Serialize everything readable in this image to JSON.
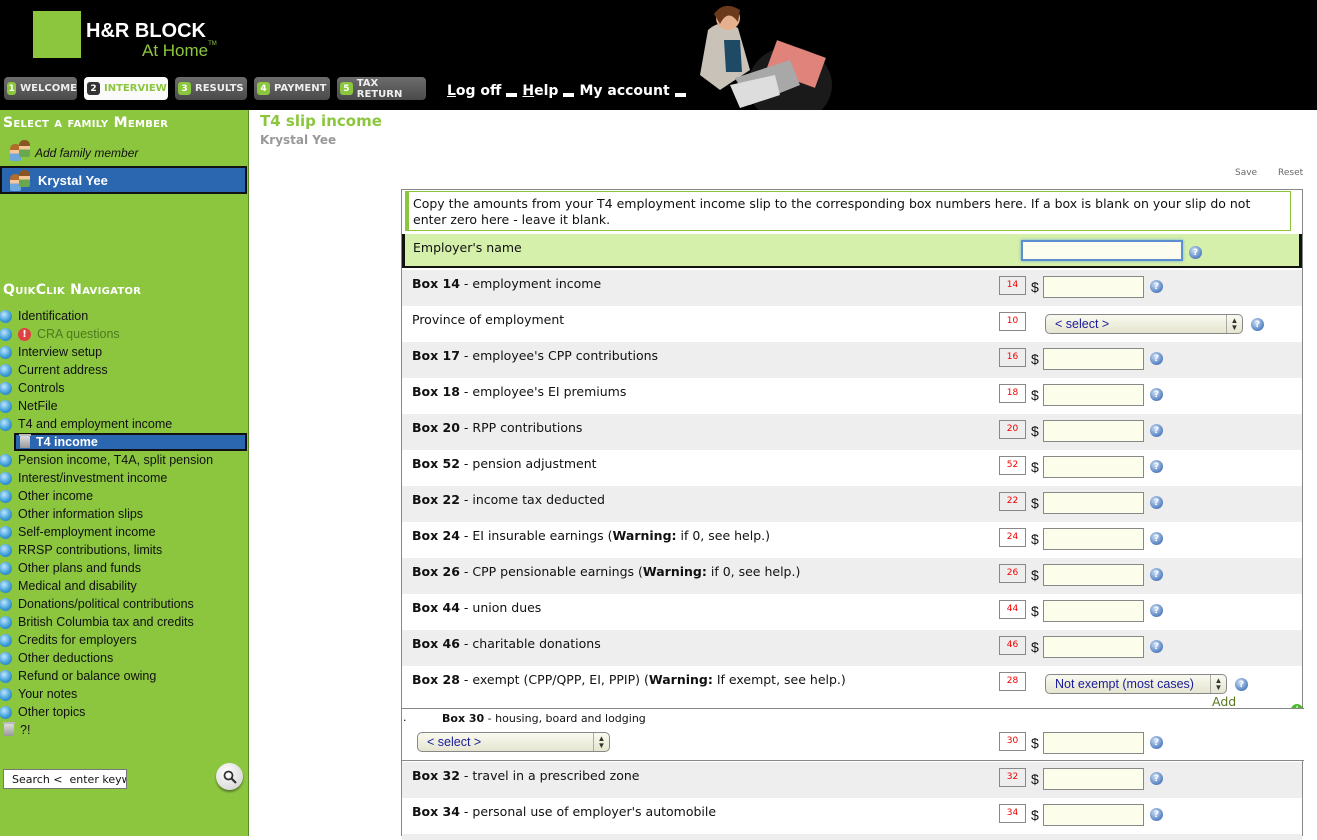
{
  "brand": {
    "line1": "H&R BLOCK",
    "line2": "At Home",
    "tm": "TM",
    "accent": "#8cc63f"
  },
  "tabs": [
    {
      "num": "1",
      "label": "WELCOME"
    },
    {
      "num": "2",
      "label": "INTERVIEW",
      "active": true
    },
    {
      "num": "3",
      "label": "RESULTS"
    },
    {
      "num": "4",
      "label": "PAYMENT"
    },
    {
      "num": "5",
      "label": "TAX RETURN"
    }
  ],
  "toplinks": {
    "logoff_u": "L",
    "logoff_rest": "og off",
    "help_u": "H",
    "help_rest": "elp",
    "account": "My account"
  },
  "sidebar": {
    "family_heading": "Select a family Member",
    "add_member": "Add family member",
    "selected_member": "Krystal Yee",
    "nav_heading": "QuikClik Navigator",
    "nav_items": [
      "Identification",
      "CRA questions",
      "Interview setup",
      "Current address",
      "Controls",
      "NetFile",
      "T4 and employment income",
      "T4 income",
      "Pension income, T4A, split pension",
      "Interest/investment income",
      "Other income",
      "Other information slips",
      "Self-employment income",
      "RRSP contributions, limits",
      "Other plans and funds",
      "Medical and disability",
      "Donations/political contributions",
      "British Columbia tax and credits",
      "Credits for employers",
      "Other deductions",
      "Refund or balance owing",
      "Your notes",
      "Other topics",
      "?!"
    ],
    "search_value": "Search <  enter keyw"
  },
  "main": {
    "title": "T4 slip income",
    "subtitle": "Krystal Yee",
    "save": "Save",
    "reset": "Reset",
    "instructions": "Copy the amounts from your T4 employment income slip to the corresponding box numbers here. If a box is blank on your slip do not enter zero here - leave it blank.",
    "employer_label": "Employer's name",
    "employer_value": "",
    "rows": [
      {
        "bold": "Box 14",
        "text": " - employment income",
        "box": "14",
        "type": "amount"
      },
      {
        "bold": "",
        "text": "Province of employment",
        "box": "10",
        "type": "select",
        "value": "<  select  >"
      },
      {
        "bold": "Box 17",
        "text": " - employee's CPP contributions",
        "box": "16",
        "type": "amount"
      },
      {
        "bold": "Box 18",
        "text": " - employee's EI premiums",
        "box": "18",
        "type": "amount"
      },
      {
        "bold": "Box 20",
        "text": " - RPP contributions",
        "box": "20",
        "type": "amount"
      },
      {
        "bold": "Box 52",
        "text": " - pension adjustment",
        "box": "52",
        "type": "amount"
      },
      {
        "bold": "Box 22",
        "text": " - income tax deducted",
        "box": "22",
        "type": "amount"
      },
      {
        "bold": "Box 24",
        "text": " - EI insurable earnings (",
        "warn": "Warning:",
        "tail": " if 0, see help.)",
        "box": "24",
        "type": "amount"
      },
      {
        "bold": "Box 26",
        "text": " - CPP pensionable earnings (",
        "warn": "Warning:",
        "tail": " if 0, see help.)",
        "box": "26",
        "type": "amount"
      },
      {
        "bold": "Box 44",
        "text": " - union dues",
        "box": "44",
        "type": "amount"
      },
      {
        "bold": "Box 46",
        "text": " - charitable donations",
        "box": "46",
        "type": "amount"
      },
      {
        "bold": "Box 28",
        "text": " - exempt (CPP/QPP, EI, PPIP) (",
        "warn": "Warning:",
        "tail": " If exempt, see help.)",
        "box": "28",
        "type": "select",
        "value": "Not exempt (most cases)"
      }
    ],
    "add_another": "Add another",
    "box30": {
      "bold": "Box 30",
      "text": " - housing, board and lodging",
      "select_value": "<  select  >",
      "box": "30"
    },
    "rows_after": [
      {
        "bold": "Box 32",
        "text": " - travel in a prescribed zone",
        "box": "32"
      },
      {
        "bold": "Box 34",
        "text": " - personal use of employer's automobile",
        "box": "34"
      }
    ]
  }
}
